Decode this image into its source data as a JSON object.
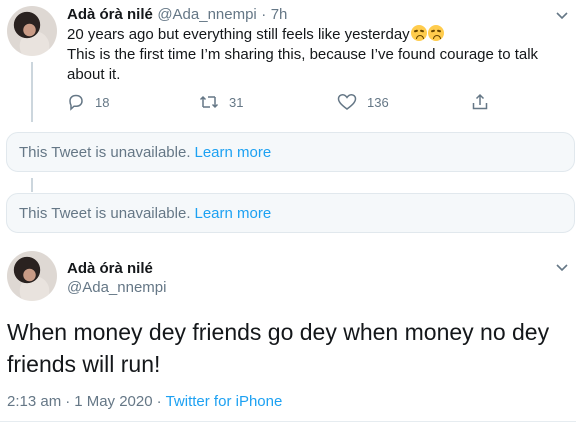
{
  "tweet1": {
    "name": "Adà órà nilé",
    "handle": "@Ada_nnempi",
    "dot": "·",
    "time": "7h",
    "line1": "20 years ago but everything still feels like yesterday",
    "emojis": [
      "disappointed-face-emoji",
      "disappointed-face-emoji"
    ],
    "line2": "This is the first time I’m sharing this, because I’ve found courage to talk",
    "line3": "about it.",
    "actions": {
      "replies": "18",
      "retweets": "31",
      "likes": "136"
    }
  },
  "unavailable": [
    {
      "text": "This Tweet is unavailable.",
      "link": "Learn more"
    },
    {
      "text": "This Tweet is unavailable.",
      "link": "Learn more"
    }
  ],
  "tweet2": {
    "name": "Adà órà nilé",
    "handle": "@Ada_nnempi",
    "line1": "When money dey friends go dey when money no dey",
    "line2": "friends will run!",
    "time": "2:13 am",
    "date": "1 May 2020",
    "sep": "·",
    "source": "Twitter for iPhone"
  },
  "colors": {
    "accent": "#1da1f2",
    "muted": "#657786",
    "line": "#ccd6dd"
  }
}
